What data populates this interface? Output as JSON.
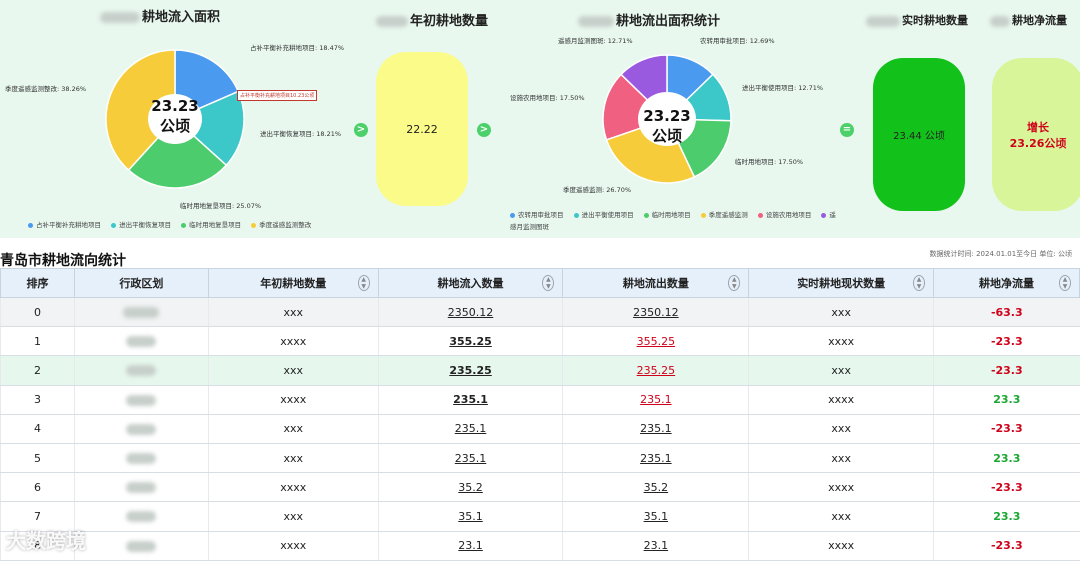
{
  "inflow": {
    "title": "耕地流入面积",
    "center_value": "23.23",
    "center_unit": "公顷",
    "labels": [
      "占补平衡补充耕地项目: 18.47%",
      "进出平衡恢复项目: 18.21%",
      "临时用地复垦项目: 25.07%",
      "季度遥感监测整改: 38.26%"
    ],
    "tooltip": "占补平衡补充耕地项目10.23公顷",
    "legend": [
      "占补平衡补充耕地项目",
      "进出平衡恢复项目",
      "临时用地复垦项目",
      "季度遥感监测整改"
    ],
    "slices": [
      18.47,
      18.21,
      25.07,
      38.26
    ],
    "colors": [
      "#4a9af0",
      "#3cc8c8",
      "#4ccc6c",
      "#f6cc3a"
    ]
  },
  "initial": {
    "title": "年初耕地数量",
    "value": "22.22"
  },
  "outflow": {
    "title": "耕地流出面积统计",
    "center_value": "23.23",
    "center_unit": "公顷",
    "labels": [
      "农转用审批项目: 12.69%",
      "进出平衡使用项目: 12.71%",
      "临时用地项目: 17.50%",
      "季度遥感监测: 26.70%",
      "设施农用地项目: 17.50%",
      "遥感月监测图斑: 12.71%"
    ],
    "legend": [
      "农转用审批项目",
      "进出平衡使用项目",
      "临时用地项目",
      "季度遥感监测",
      "设施农用地项目",
      "遥感月监测图斑"
    ],
    "slices": [
      12.69,
      12.71,
      17.5,
      26.7,
      17.5,
      12.71
    ],
    "colors": [
      "#4a9af0",
      "#3cc8c8",
      "#4ccc6c",
      "#f6cc3a",
      "#f06080",
      "#9a5ae0"
    ]
  },
  "realtime": {
    "title": "实时耕地数量",
    "value": "23.44 公顷"
  },
  "net": {
    "title": "耕地净流量",
    "line1": "增长",
    "line2": "23.26公顷"
  },
  "arrow_symbol": ">",
  "equals_symbol": "=",
  "table": {
    "title": "青岛市耕地流向统计",
    "meta": "数据统计时间: 2024.01.01至今日   单位: 公顷",
    "headers": [
      "排序",
      "行政区划",
      "年初耕地数量",
      "耕地流入数量",
      "耕地流出数量",
      "实时耕地现状数量",
      "耕地净流量"
    ],
    "rows": [
      {
        "rank": "0",
        "initial": "xxx",
        "inflow": "2350.12",
        "outflow": "2350.12",
        "current": "xxx",
        "net": "-63.3"
      },
      {
        "rank": "1",
        "initial": "xxxx",
        "inflow": "355.25",
        "outflow": "355.25",
        "current": "xxxx",
        "net": "-23.3"
      },
      {
        "rank": "2",
        "initial": "xxx",
        "inflow": "235.25",
        "outflow": "235.25",
        "current": "xxx",
        "net": "-23.3"
      },
      {
        "rank": "3",
        "initial": "xxxx",
        "inflow": "235.1",
        "outflow": "235.1",
        "current": "xxxx",
        "net": "23.3"
      },
      {
        "rank": "4",
        "initial": "xxx",
        "inflow": "235.1",
        "outflow": "235.1",
        "current": "xxx",
        "net": "-23.3"
      },
      {
        "rank": "5",
        "initial": "xxx",
        "inflow": "235.1",
        "outflow": "235.1",
        "current": "xxx",
        "net": "23.3"
      },
      {
        "rank": "6",
        "initial": "xxxx",
        "inflow": "35.2",
        "outflow": "35.2",
        "current": "xxxx",
        "net": "-23.3"
      },
      {
        "rank": "7",
        "initial": "xxx",
        "inflow": "35.1",
        "outflow": "35.1",
        "current": "xxx",
        "net": "23.3"
      },
      {
        "rank": "8",
        "initial": "xxxx",
        "inflow": "23.1",
        "outflow": "23.1",
        "current": "xxxx",
        "net": "-23.3"
      }
    ]
  },
  "watermark": "大数跨境"
}
